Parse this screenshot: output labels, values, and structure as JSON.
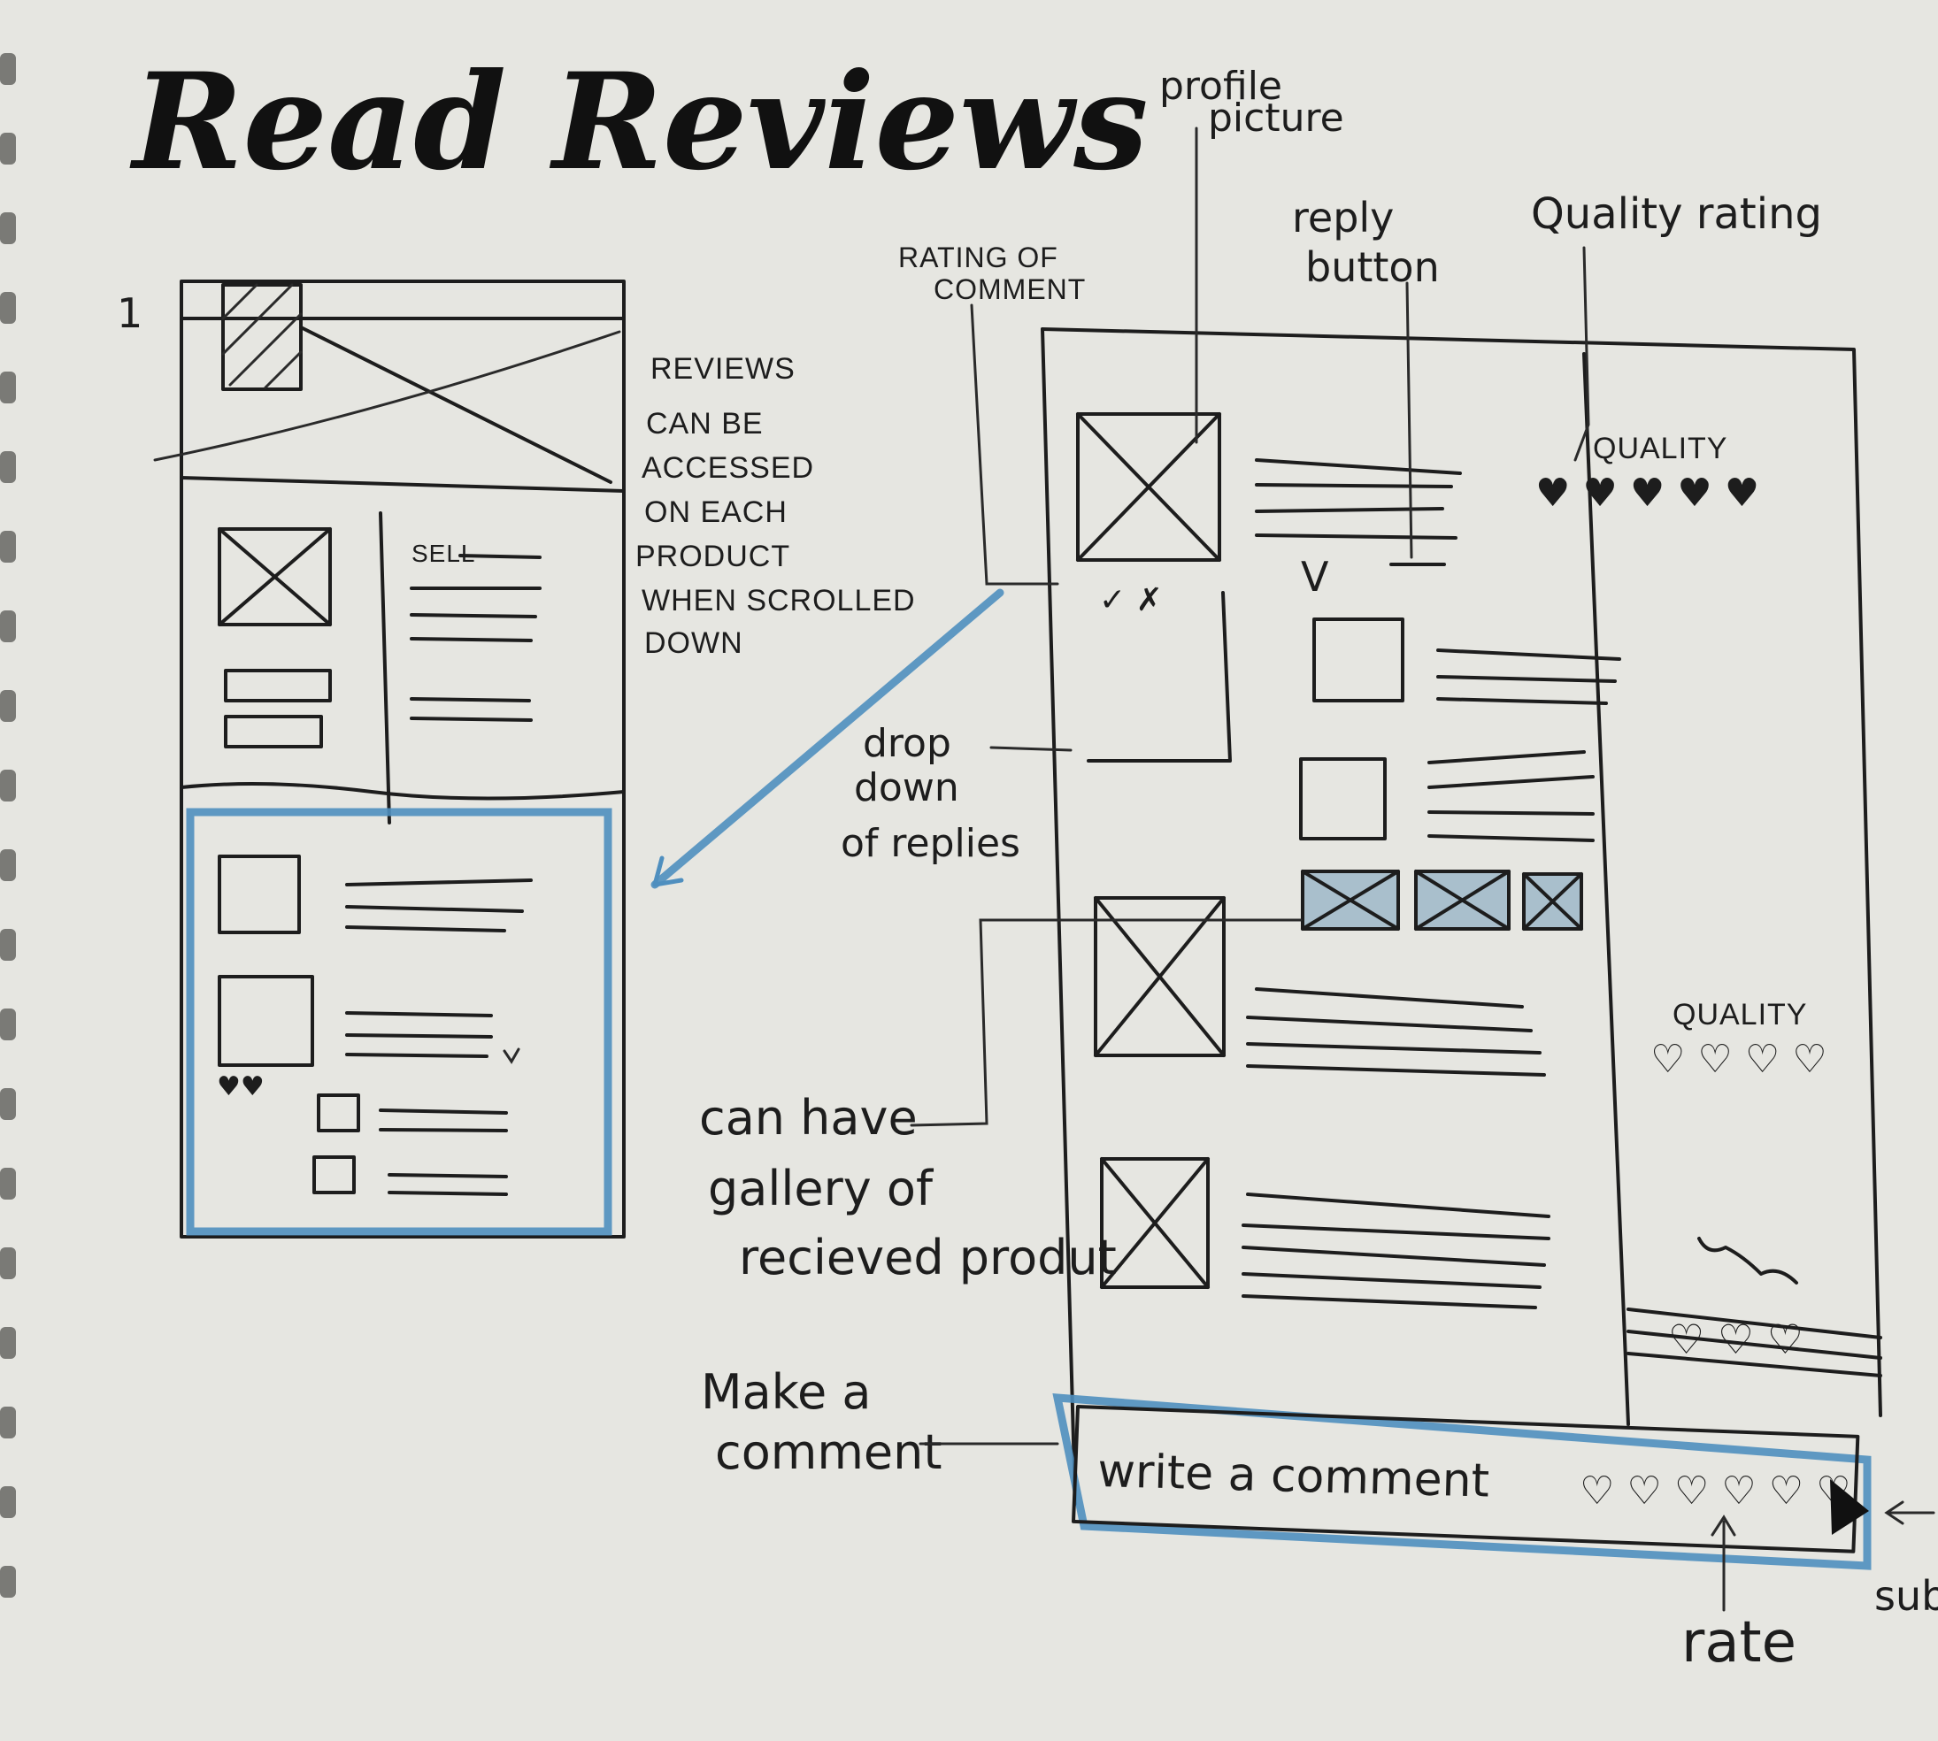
{
  "title": "Read Reviews",
  "page_number": "1",
  "left_wireframe": {
    "sell_label": "SELL",
    "note": [
      "REVIEWS",
      "CAN BE",
      "ACCESSED",
      "ON EACH",
      "PRODUCT",
      "WHEN SCROLLED",
      "DOWN"
    ]
  },
  "annotations": {
    "profile_picture": [
      "profile",
      "picture"
    ],
    "rating_of_comment": [
      "RATING OF",
      "COMMENT"
    ],
    "reply_button": [
      "reply",
      "button"
    ],
    "quality_rating": "Quality rating",
    "dropdown_replies": [
      "drop",
      "down",
      "of replies"
    ],
    "gallery": [
      "can have",
      "gallery of",
      "recieved produt"
    ],
    "make_comment": [
      "Make a",
      "comment"
    ],
    "rate": "rate",
    "submit": "sub"
  },
  "review_panel": {
    "quality_label_1": "QUALITY",
    "quality_label_2": "QUALITY",
    "rating_marks": "✓ ✗",
    "reply_chevron": "V",
    "comment_placeholder": "write a comment",
    "hearts_icon": "heart-icon",
    "send_icon": "send-triangle-icon"
  },
  "colors": {
    "paper": "#e6e6e1",
    "ink": "#1d1d1d",
    "highlight": "#4f8fbf"
  }
}
